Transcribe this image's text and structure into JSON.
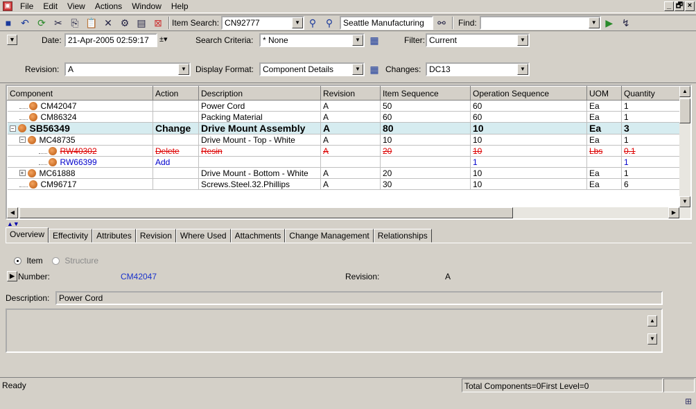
{
  "menu": {
    "app_icon": "app-icon",
    "items": [
      "File",
      "Edit",
      "View",
      "Actions",
      "Window",
      "Help"
    ]
  },
  "window_controls": {
    "minimize": "_",
    "restore": "🗗",
    "close": "×"
  },
  "toolbar": {
    "item_search_label": "Item Search:",
    "item_search_value": "CN92777",
    "site_value": "Seattle Manufacturing",
    "find_label": "Find:",
    "find_value": ""
  },
  "criteria": {
    "date_label": "Date:",
    "date_value": "21-Apr-2005 02:59:17",
    "search_criteria_label": "Search Criteria:",
    "search_criteria_value": "* None",
    "filter_label": "Filter:",
    "filter_value": "Current",
    "revision_label": "Revision:",
    "revision_value": "A",
    "display_format_label": "Display Format:",
    "display_format_value": "Component Details",
    "changes_label": "Changes:",
    "changes_value": "DC13"
  },
  "grid": {
    "columns": [
      "Component",
      "Action",
      "Description",
      "Revision",
      "Item Sequence",
      "Operation Sequence",
      "UOM",
      "Quantity"
    ],
    "rows": [
      {
        "component": "CM42047",
        "action": "",
        "description": "Power Cord",
        "revision": "A",
        "item_seq": "50",
        "op_seq": "60",
        "uom": "Ea",
        "qty": "1",
        "indent": 1,
        "expander": "",
        "style": ""
      },
      {
        "component": "CM86324",
        "action": "",
        "description": "Packing Material",
        "revision": "A",
        "item_seq": "60",
        "op_seq": "60",
        "uom": "Ea",
        "qty": "1",
        "indent": 1,
        "expander": "",
        "style": ""
      },
      {
        "component": "SB56349",
        "action": "Change",
        "description": "Drive Mount Assembly",
        "revision": "A",
        "item_seq": "80",
        "op_seq": "10",
        "uom": "Ea",
        "qty": "3",
        "indent": 0,
        "expander": "−",
        "style": "sel"
      },
      {
        "component": "MC48735",
        "action": "",
        "description": "Drive Mount - Top - White",
        "revision": "A",
        "item_seq": "10",
        "op_seq": "10",
        "uom": "Ea",
        "qty": "1",
        "indent": 1,
        "expander": "−",
        "style": ""
      },
      {
        "component": "RW40302",
        "action": "Delete",
        "description": "Resin",
        "revision": "A",
        "item_seq": "20",
        "op_seq": "10",
        "uom": "Lbs",
        "qty": "0.1",
        "indent": 3,
        "expander": "",
        "style": "del"
      },
      {
        "component": "RW66399",
        "action": "Add",
        "description": "",
        "revision": "",
        "item_seq": "",
        "op_seq": "1",
        "uom": "",
        "qty": "1",
        "indent": 3,
        "expander": "",
        "style": "add"
      },
      {
        "component": "MC61888",
        "action": "",
        "description": "Drive Mount - Bottom - White",
        "revision": "A",
        "item_seq": "20",
        "op_seq": "10",
        "uom": "Ea",
        "qty": "1",
        "indent": 1,
        "expander": "+",
        "style": ""
      },
      {
        "component": "CM96717",
        "action": "",
        "description": "Screws.Steel.32.Phillips",
        "revision": "A",
        "item_seq": "30",
        "op_seq": "10",
        "uom": "Ea",
        "qty": "6",
        "indent": 1,
        "expander": "",
        "style": ""
      }
    ]
  },
  "tabs": [
    "Overview",
    "Effectivity",
    "Attributes",
    "Revision",
    "Where Used",
    "Attachments",
    "Change Management",
    "Relationships"
  ],
  "overview": {
    "radio_item": "Item",
    "radio_structure": "Structure",
    "number_label": "Number:",
    "number_value": "CM42047",
    "revision_label": "Revision:",
    "revision_value": "A",
    "description_label": "Description:",
    "description_value": "Power Cord"
  },
  "status": {
    "left": "Ready",
    "right": "Total Components=0First Level=0"
  },
  "colors": {
    "accent_link": "#1a33cc",
    "selected_row": "#d6ecf0",
    "deleted": "#dd0000",
    "added": "#0000cc"
  }
}
